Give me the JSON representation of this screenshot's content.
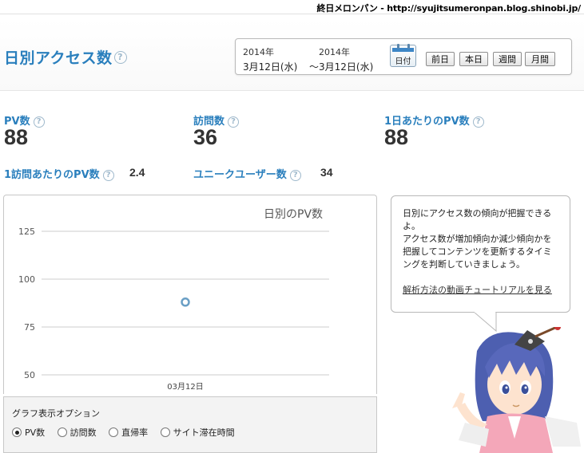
{
  "topbar": {
    "text": "終日メロンパン - http://syujitsumeronpan.blog.shinobi.jp/"
  },
  "page": {
    "title": "日別アクセス数",
    "help_glyph": "?"
  },
  "date_range": {
    "start_year": "2014年",
    "start_day": "3月12日(水)",
    "end_year": "2014年",
    "end_day": "〜3月12日(水)",
    "calendar_label": "日付",
    "buttons": [
      "前日",
      "本日",
      "週間",
      "月間"
    ]
  },
  "metrics": {
    "pv": {
      "label": "PV数",
      "value": "88"
    },
    "visits": {
      "label": "訪問数",
      "value": "36"
    },
    "daily_pv": {
      "label": "1日あたりのPV数",
      "value": "88"
    },
    "pv_per_visit": {
      "label": "1訪問あたりのPV数",
      "value": "2.4"
    },
    "unique_users": {
      "label": "ユニークユーザー数",
      "value": "34"
    }
  },
  "chart_data": {
    "type": "line",
    "title": "日別のPV数",
    "categories": [
      "03月12日"
    ],
    "series": [
      {
        "values": [
          88
        ]
      }
    ],
    "y_ticks": [
      50,
      75,
      100,
      125
    ],
    "ylim": [
      50,
      125
    ],
    "grid": true,
    "point_color": "#6a9fc5"
  },
  "options": {
    "title": "グラフ表示オプション",
    "items": [
      {
        "label": "PV数",
        "checked": true
      },
      {
        "label": "訪問数",
        "checked": false
      },
      {
        "label": "直帰率",
        "checked": false
      },
      {
        "label": "サイト滞在時間",
        "checked": false
      }
    ]
  },
  "bubble": {
    "lines": [
      "日別にアクセス数の傾向が把握できる",
      "よ。",
      "アクセス数が増加傾向か減少傾向かを",
      "把握してコンテンツを更新するタイミ",
      "ングを判断していきましょう。"
    ],
    "link": "解析方法の動画チュートリアルを見る"
  },
  "colors": {
    "accent": "#2a7fbd",
    "value": "#333333"
  }
}
